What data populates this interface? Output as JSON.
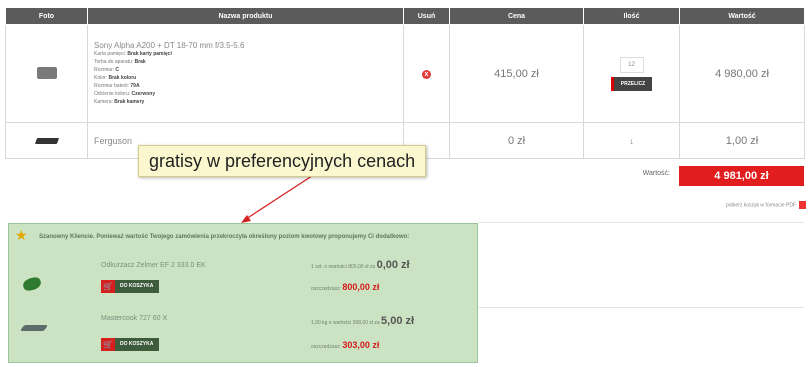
{
  "table": {
    "headers": [
      "Foto",
      "Nazwa produktu",
      "Usuń",
      "Cena",
      "Ilość",
      "Wartość"
    ],
    "rows": [
      {
        "name": "Sony Alpha A200 + DT 18-70 mm f/3.5-5.6",
        "attrs": [
          {
            "label": "Karta pamięci:",
            "value": "Brak karty pamięci"
          },
          {
            "label": "Torba do aparatu:",
            "value": "Brak"
          },
          {
            "label": "Rozmiar:",
            "value": "C"
          },
          {
            "label": "Kolor:",
            "value": "Brak koloru"
          },
          {
            "label": "Rozmiar baterii:",
            "value": "79A"
          },
          {
            "label": "Odcienie koloru:",
            "value": "Czerwony"
          },
          {
            "label": "Kamera:",
            "value": "Brak kamery"
          }
        ],
        "remove_icon": "x",
        "price": "415,00 zł",
        "qty": "12",
        "recalc_label": "PRZELICZ",
        "value": "4 980,00 zł"
      },
      {
        "name": "Ferguson",
        "price": "0 zł",
        "qty": "1",
        "value": "1,00 zł"
      }
    ]
  },
  "total": {
    "label": "Wartość:",
    "value": "4 981,00 zł"
  },
  "pdf_label": "pobierz koszyk w formacie PDF",
  "callout": "gratisy w preferencyjnych cenach",
  "promo": {
    "heading": "Szanowny Kliencie. Ponieważ wartość Twojego zamówienia przekroczyła określony poziom kwotowy proponujemy Ci dodatkowo:",
    "items": [
      {
        "name": "Odkurzacz Zelmer EF 2 333.0 EK",
        "button": "DO KOSZYKA",
        "offer_prefix": "1 szt. o wartości 800,00 zł za",
        "offer_price": "0,00 zł",
        "saving_label": "oszczędzasz:",
        "saving_value": "800,00 zł"
      },
      {
        "name": "Mastercook 727 60 X",
        "button": "DO KOSZYKA",
        "offer_prefix": "1,00 kg o wartości 308,00 zł za",
        "offer_price": "5,00 zł",
        "saving_label": "oszczędzasz:",
        "saving_value": "303,00 zł"
      }
    ]
  },
  "colors": {
    "accent_red": "#e21d1d",
    "header_gray": "#5b5b5b",
    "promo_green": "#cbe3c3",
    "button_green": "#3d5c3b"
  },
  "icons": {
    "remove": "remove-icon",
    "star": "star-icon",
    "cart": "cart-icon",
    "pdf": "pdf-icon"
  }
}
